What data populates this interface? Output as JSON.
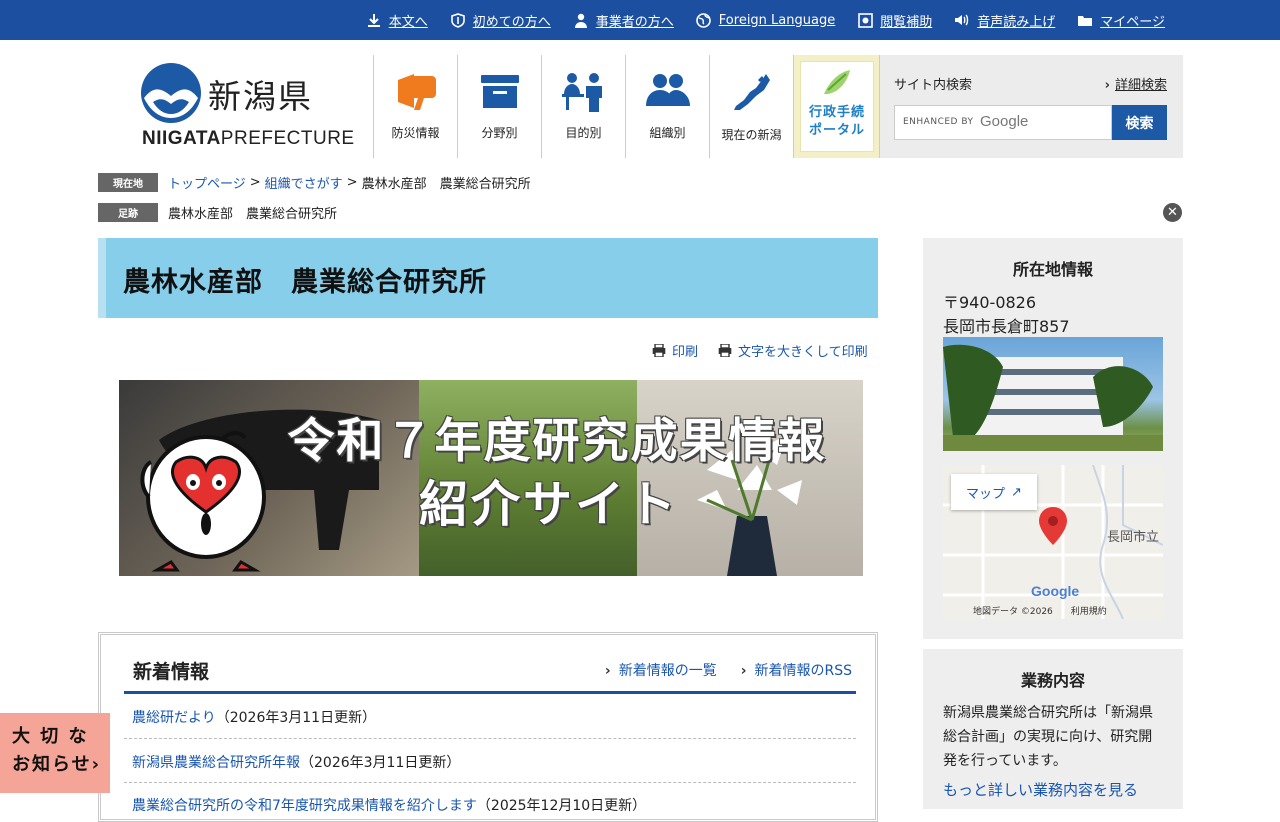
{
  "topbar": {
    "links": [
      {
        "icon": "download-arrow-icon",
        "label": "本文へ"
      },
      {
        "icon": "shield-leaf-icon",
        "label": "初めての方へ"
      },
      {
        "icon": "person-icon",
        "label": "事業者の方へ"
      },
      {
        "icon": "globe-icon",
        "label": "Foreign Language"
      },
      {
        "icon": "view-assist-icon",
        "label": "閲覧補助"
      },
      {
        "icon": "speaker-icon",
        "label": "音声読み上げ"
      },
      {
        "icon": "folder-icon",
        "label": "マイページ"
      }
    ]
  },
  "logo": {
    "jp": "新潟県",
    "en_bold": "NIIGATA",
    "en_rest": "PREFECTURE"
  },
  "gnav": {
    "items": [
      {
        "icon": "megaphone-icon",
        "label": "防災情報"
      },
      {
        "icon": "box-icon",
        "label": "分野別"
      },
      {
        "icon": "people-desk-icon",
        "label": "目的別"
      },
      {
        "icon": "group-icon",
        "label": "組織別"
      },
      {
        "icon": "niigata-map-icon",
        "label": "現在の新潟"
      }
    ],
    "portal": {
      "line1": "行政手続",
      "line2": "ポータル"
    }
  },
  "search": {
    "title": "サイト内検索",
    "advanced": "詳細検索",
    "enhanced": "ENHANCED BY",
    "google": "Google",
    "button": "検索"
  },
  "breadcrumb": {
    "tag": "現在地",
    "links": [
      "トップページ",
      "組織でさがす"
    ],
    "current": "農林水産部　農業総合研究所"
  },
  "footprint": {
    "tag": "足跡",
    "text": "農林水産部　農業総合研究所"
  },
  "page": {
    "title": "農林水産部　農業総合研究所"
  },
  "print": {
    "print": "印刷",
    "print_large": "文字を大きくして印刷"
  },
  "banner": {
    "line1": "令和７年度研究成果情報",
    "line2": "紹介サイト"
  },
  "news": {
    "heading": "新着情報",
    "list_link": "新着情報の一覧",
    "rss_link": "新着情報のRSS",
    "items": [
      {
        "link": "農総研だより",
        "date": "（2026年3月11日更新）"
      },
      {
        "link": "新潟県農業総合研究所年報",
        "date": "（2026年3月11日更新）"
      },
      {
        "link": "農業総合研究所の令和7年度研究成果情報を紹介します",
        "date": "（2025年12月10日更新）"
      }
    ]
  },
  "location": {
    "heading": "所在地情報",
    "postal": "〒940-0826",
    "address": "長岡市長倉町857",
    "map_button": "マップ",
    "map_city": "長岡市立",
    "map_footer": "地図データ ©2026　　利用規約",
    "map_logo": "Google"
  },
  "business": {
    "heading": "業務内容",
    "desc": "新潟県農業総合研究所は「新潟県総合計画」の実現に向け、研究開発を行っています。",
    "more": "もっと詳しい業務内容を見る"
  },
  "notice": {
    "line1": "大 切 な",
    "line2": "お知らせ"
  }
}
